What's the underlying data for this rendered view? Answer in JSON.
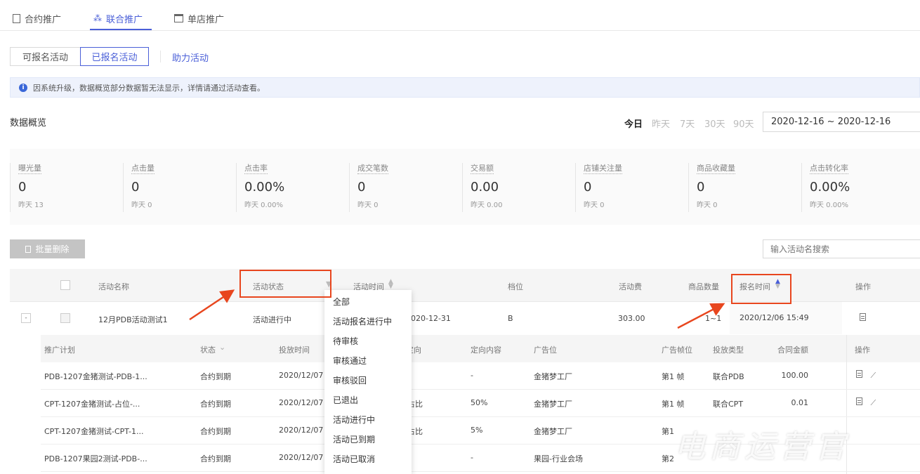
{
  "tabs": [
    {
      "label": "合约推广",
      "icon": "contract-icon"
    },
    {
      "label": "联合推广",
      "icon": "network-icon",
      "active": true
    },
    {
      "label": "单店推广",
      "icon": "store-icon"
    }
  ],
  "segments": [
    {
      "label": "可报名活动"
    },
    {
      "label": "已报名活动",
      "active": true
    }
  ],
  "assist_link": "助力活动",
  "notice": "因系统升级，数据概览部分数据暂无法显示，详情请通过活动查看。",
  "overview": {
    "title": "数据概览",
    "ranges": [
      "今日",
      "昨天",
      "7天",
      "30天",
      "90天"
    ],
    "active_range": "今日",
    "date_range": "2020-12-16 ~ 2020-12-16",
    "stats": [
      {
        "label": "曝光量",
        "value": "0",
        "prev": "昨天 13"
      },
      {
        "label": "点击量",
        "value": "0",
        "prev": "昨天 0"
      },
      {
        "label": "点击率",
        "value": "0.00%",
        "prev": "昨天 0.00%"
      },
      {
        "label": "成交笔数",
        "value": "0",
        "prev": "昨天 0"
      },
      {
        "label": "交易额",
        "value": "0.00",
        "prev": "昨天 0.00"
      },
      {
        "label": "店铺关注量",
        "value": "0",
        "prev": "昨天 0"
      },
      {
        "label": "商品收藏量",
        "value": "0",
        "prev": "昨天 0"
      },
      {
        "label": "点击转化率",
        "value": "0.00%",
        "prev": "昨天 0.00%"
      }
    ]
  },
  "toolbar": {
    "batch_delete": "批量删除",
    "search_placeholder": "输入活动名搜索"
  },
  "table": {
    "headers": {
      "name": "活动名称",
      "status": "活动状态",
      "time": "活动时间",
      "tier": "档位",
      "fee": "活动费",
      "qty": "商品数量",
      "signup": "报名时间",
      "ops": "操作"
    },
    "row": {
      "expand": "-",
      "name": "12月PDB活动测试1",
      "status": "活动进行中",
      "time": "2020-12-31",
      "tier": "B",
      "fee": "303.00",
      "qty": "1~1",
      "signup": "2020/12/06 15:49"
    },
    "sub_headers": {
      "plan": "推广计划",
      "status": "状态",
      "time": "投放时间",
      "target": "定向",
      "target_content": "定向内容",
      "slot": "广告位",
      "frame": "广告帧位",
      "type": "投放类型",
      "amount": "合同金额",
      "ops": "操作"
    },
    "sub_rows": [
      {
        "plan": "PDB-1207金猪测试-PDB-1...",
        "status": "合约到期",
        "time": "2020/12/07 -",
        "target": "",
        "target_content": "-",
        "slot": "金猪梦工厂",
        "frame": "第1 帧",
        "type": "联合PDB",
        "amount": "100.00"
      },
      {
        "plan": "CPT-1207金猪测试-占位-...",
        "status": "合约到期",
        "time": "2020/12/07 -",
        "target": "占比",
        "target_content": "50%",
        "slot": "金猪梦工厂",
        "frame": "第1 帧",
        "type": "联合CPT",
        "amount": "0.01"
      },
      {
        "plan": "CPT-1207金猪测试-CPT-1...",
        "status": "合约到期",
        "time": "2020/12/07 -",
        "target": "占比",
        "target_content": "5%",
        "slot": "金猪梦工厂",
        "frame": "第1",
        "type": "",
        "amount": ""
      },
      {
        "plan": "PDB-1207果园2测试-PDB-...",
        "status": "合约到期",
        "time": "2020/12/07 -",
        "target": "",
        "target_content": "-",
        "slot": "果园-行业会场",
        "frame": "第2",
        "type": "",
        "amount": ""
      }
    ]
  },
  "status_filter": {
    "options": [
      "全部",
      "活动报名进行中",
      "待审核",
      "审核通过",
      "审核驳回",
      "已退出",
      "活动进行中",
      "活动已到期",
      "活动已取消"
    ]
  },
  "colors": {
    "accent": "#4a5fd8",
    "annotation": "#e8461e"
  },
  "watermark": "电商运营官"
}
